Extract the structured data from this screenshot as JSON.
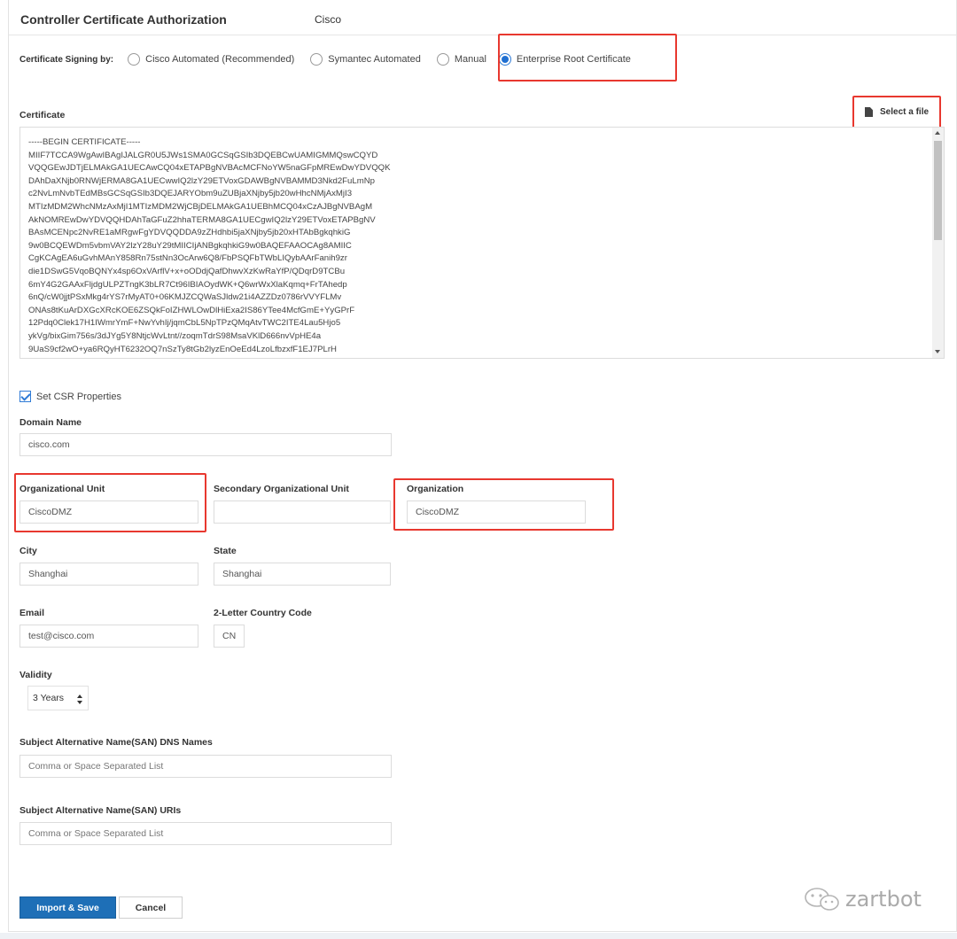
{
  "header": {
    "title": "Controller Certificate Authorization",
    "vendor": "Cisco"
  },
  "signing": {
    "label": "Certificate Signing by:",
    "options": [
      {
        "label": "Cisco Automated (Recommended)",
        "checked": false
      },
      {
        "label": "Symantec Automated",
        "checked": false
      },
      {
        "label": "Manual",
        "checked": false
      },
      {
        "label": "Enterprise Root Certificate",
        "checked": true
      }
    ]
  },
  "certificate": {
    "label": "Certificate",
    "select_file": "Select a file",
    "text": "-----BEGIN CERTIFICATE-----\nMIIF7TCCA9WgAwIBAgIJALGR0U5JWs1SMA0GCSqGSIb3DQEBCwUAMIGMMQswCQYD\nVQQGEwJDTjELMAkGA1UECAwCQ04xETAPBgNVBAcMCFNoYW5naGFpMREwDwYDVQQK\nDAhDaXNjb0RNWjERMA8GA1UECwwIQ2lzY29ETVoxGDAWBgNVBAMMD3Nkd2FuLmNp\nc2NvLmNvbTEdMBsGCSqGSIb3DQEJARYObm9uZUBjaXNjby5jb20wHhcNMjAxMjI3\nMTIzMDM2WhcNMzAxMjI1MTIzMDM2WjCBjDELMAkGA1UEBhMCQ04xCzAJBgNVBAgM\nAkNOMREwDwYDVQQHDAhTaGFuZ2hhaTERMA8GA1UECgwIQ2lzY29ETVoxETAPBgNV\nBAsMCENpc2NvRE1aMRgwFgYDVQQDDA9zZHdhbi5jaXNjby5jb20xHTAbBgkqhkiG\n9w0BCQEWDm5vbmVAY2lzY28uY29tMIICIjANBgkqhkiG9w0BAQEFAAOCAg8AMIIC\nCgKCAgEA6uGvhMAnY858Rn75stNn3OcArw6Q8/FbPSQFbTWbLIQybAArFanih9zr\ndie1DSwG5VqoBQNYx4sp6OxVArflV+x+oODdjQafDhwvXzKwRaYfP/QDqrD9TCBu\n6mY4G2GAAxFljdgULPZTngK3bLR7Ct96IBIAOydWK+Q6wrWxXlaKqmq+FrTAhedp\n6nQ/cW0jjtPSxMkg4rYS7rMyAT0+06KMJZCQWaSJldw21i4AZZDz0786rVVYFLMv\nONAs8tKuArDXGcXRcKOE6ZSQkFoIZHWLOwDlHiExa2IS86YTee4McfGmE+YyGPrF\n12Pdq0Clek17H1IWmrYmF+NwYvhIj/jqmCbL5NpTPzQMqAtvTWC2ITE4Lau5Hjo5\nykVg/bixGim756s/3dJYg5Y8NtjcWvLtnt//zoqmTdrS98MsaVKlD666nvVpHE4a\n9UaS9cf2wO+ya6RQyHT6232OQ7nSzTy8tGb2lyzEnOeEd4LzoLfbzxfF1EJ7PLrH"
  },
  "csr": {
    "label": "Set CSR Properties",
    "checked": true,
    "domain": {
      "label": "Domain Name",
      "value": "cisco.com"
    },
    "org_unit": {
      "label": "Organizational Unit",
      "value": "CiscoDMZ"
    },
    "secondary_org_unit": {
      "label": "Secondary Organizational Unit",
      "value": ""
    },
    "organization": {
      "label": "Organization",
      "value": "CiscoDMZ"
    },
    "city": {
      "label": "City",
      "value": "Shanghai"
    },
    "state": {
      "label": "State",
      "value": "Shanghai"
    },
    "email": {
      "label": "Email",
      "value": "test@cisco.com"
    },
    "country": {
      "label": "2-Letter Country Code",
      "value": "CN"
    },
    "validity": {
      "label": "Validity",
      "value": "3 Years"
    },
    "san_dns": {
      "label": "Subject Alternative Name(SAN) DNS Names",
      "placeholder": "Comma or Space Separated List"
    },
    "san_uri": {
      "label": "Subject Alternative Name(SAN) URIs",
      "placeholder": "Comma or Space Separated List"
    }
  },
  "actions": {
    "import_save": "Import & Save",
    "cancel": "Cancel"
  },
  "watermark": {
    "text": "zartbot"
  },
  "colors": {
    "primary": "#1e6fb7",
    "highlight": "#e8382f",
    "radio_checked": "#1f6fd1"
  }
}
